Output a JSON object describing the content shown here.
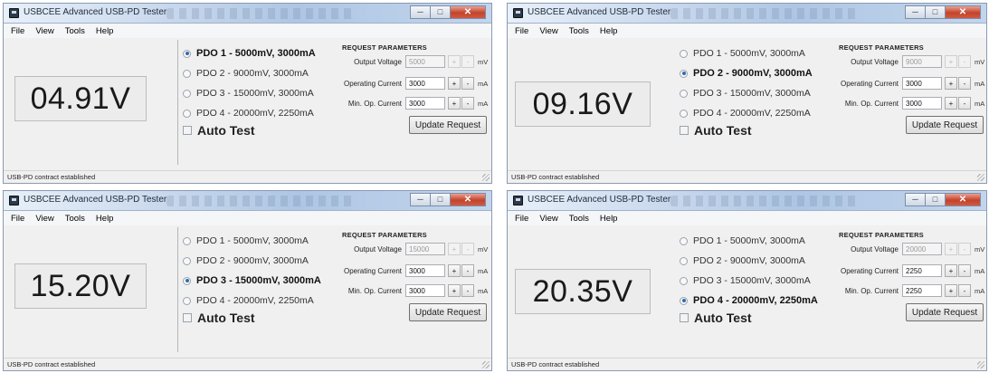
{
  "app": {
    "title": "USBCEE Advanced USB-PD Tester"
  },
  "menu": [
    "File",
    "View",
    "Tools",
    "Help"
  ],
  "window_buttons": {
    "minimize": "─",
    "maximize": "□",
    "close": "✕"
  },
  "request": {
    "title": "REQUEST PARAMETERS",
    "output_voltage_label": "Output Voltage",
    "operating_current_label": "Operating Current",
    "min_op_current_label": "Min. Op. Current",
    "unit_mv": "mV",
    "unit_ma": "mA",
    "plus": "+",
    "minus": "-"
  },
  "auto_test_label": "Auto Test",
  "update_button_label": "Update Request",
  "status_text": "USB-PD contract established",
  "pdos": [
    "PDO 1 - 5000mV, 3000mA",
    "PDO 2 - 9000mV, 3000mA",
    "PDO 3 - 15000mV, 3000mA",
    "PDO 4 - 20000mV, 2250mA"
  ],
  "panels": [
    {
      "voltage": "04.91V",
      "selected": 0,
      "output_voltage": "5000",
      "operating_current": "3000",
      "min_op_current": "3000"
    },
    {
      "voltage": "09.16V",
      "selected": 1,
      "output_voltage": "9000",
      "operating_current": "3000",
      "min_op_current": "3000"
    },
    {
      "voltage": "15.20V",
      "selected": 2,
      "output_voltage": "15000",
      "operating_current": "3000",
      "min_op_current": "3000"
    },
    {
      "voltage": "20.35V",
      "selected": 3,
      "output_voltage": "20000",
      "operating_current": "2250",
      "min_op_current": "2250"
    }
  ]
}
